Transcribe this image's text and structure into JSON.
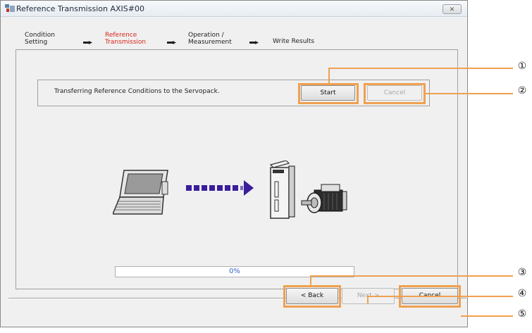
{
  "window": {
    "title": "Reference Transmission AXIS#00",
    "close_label": "✕"
  },
  "steps": [
    {
      "label": "Condition\nSetting",
      "active": false
    },
    {
      "label": "Reference\nTransmission",
      "active": true
    },
    {
      "label": "Operation /\nMeasurement",
      "active": false
    },
    {
      "label": "Write Results",
      "active": false
    }
  ],
  "group": {
    "text": "Transferring Reference Conditions to the Servopack.",
    "start_label": "Start",
    "cancel_label": "Cancel"
  },
  "progress": {
    "value": 0,
    "text": "0%"
  },
  "footer": {
    "back_label": "< Back",
    "next_label": "Next >",
    "cancel_label": "Cancel"
  },
  "callouts": [
    "①",
    "②",
    "③",
    "④",
    "⑤"
  ],
  "colors": {
    "highlight": "#f0a050",
    "active_step": "#d9251c",
    "transfer_arrow": "#3a1e9c"
  }
}
